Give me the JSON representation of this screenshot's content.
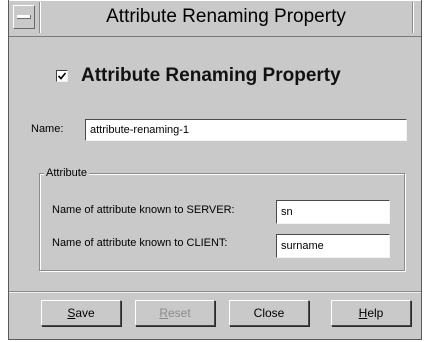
{
  "window": {
    "title": "Attribute Renaming Property"
  },
  "property": {
    "enabled_label": "Attribute Renaming Property",
    "enabled_checked": true
  },
  "name": {
    "label": "Name:",
    "value": "attribute-renaming-1"
  },
  "attribute_group": {
    "legend": "Attribute",
    "server_label": "Name of attribute known to SERVER:",
    "server_value": "sn",
    "client_label": "Name of attribute known to CLIENT:",
    "client_value": "surname"
  },
  "buttons": {
    "save": {
      "mnemonic": "S",
      "rest": "ave",
      "enabled": true
    },
    "reset": {
      "mnemonic": "R",
      "rest": "eset",
      "enabled": false
    },
    "close": {
      "label": "Close",
      "enabled": true
    },
    "help": {
      "mnemonic": "H",
      "rest": "elp",
      "enabled": true
    }
  },
  "icons": {
    "system_menu": "window-menu-icon",
    "checkbox_mark": "checkmark-icon"
  },
  "colors": {
    "window_bg": "#c9c9c9",
    "field_bg": "#ffffff",
    "disabled_text": "#8c8c8c"
  }
}
